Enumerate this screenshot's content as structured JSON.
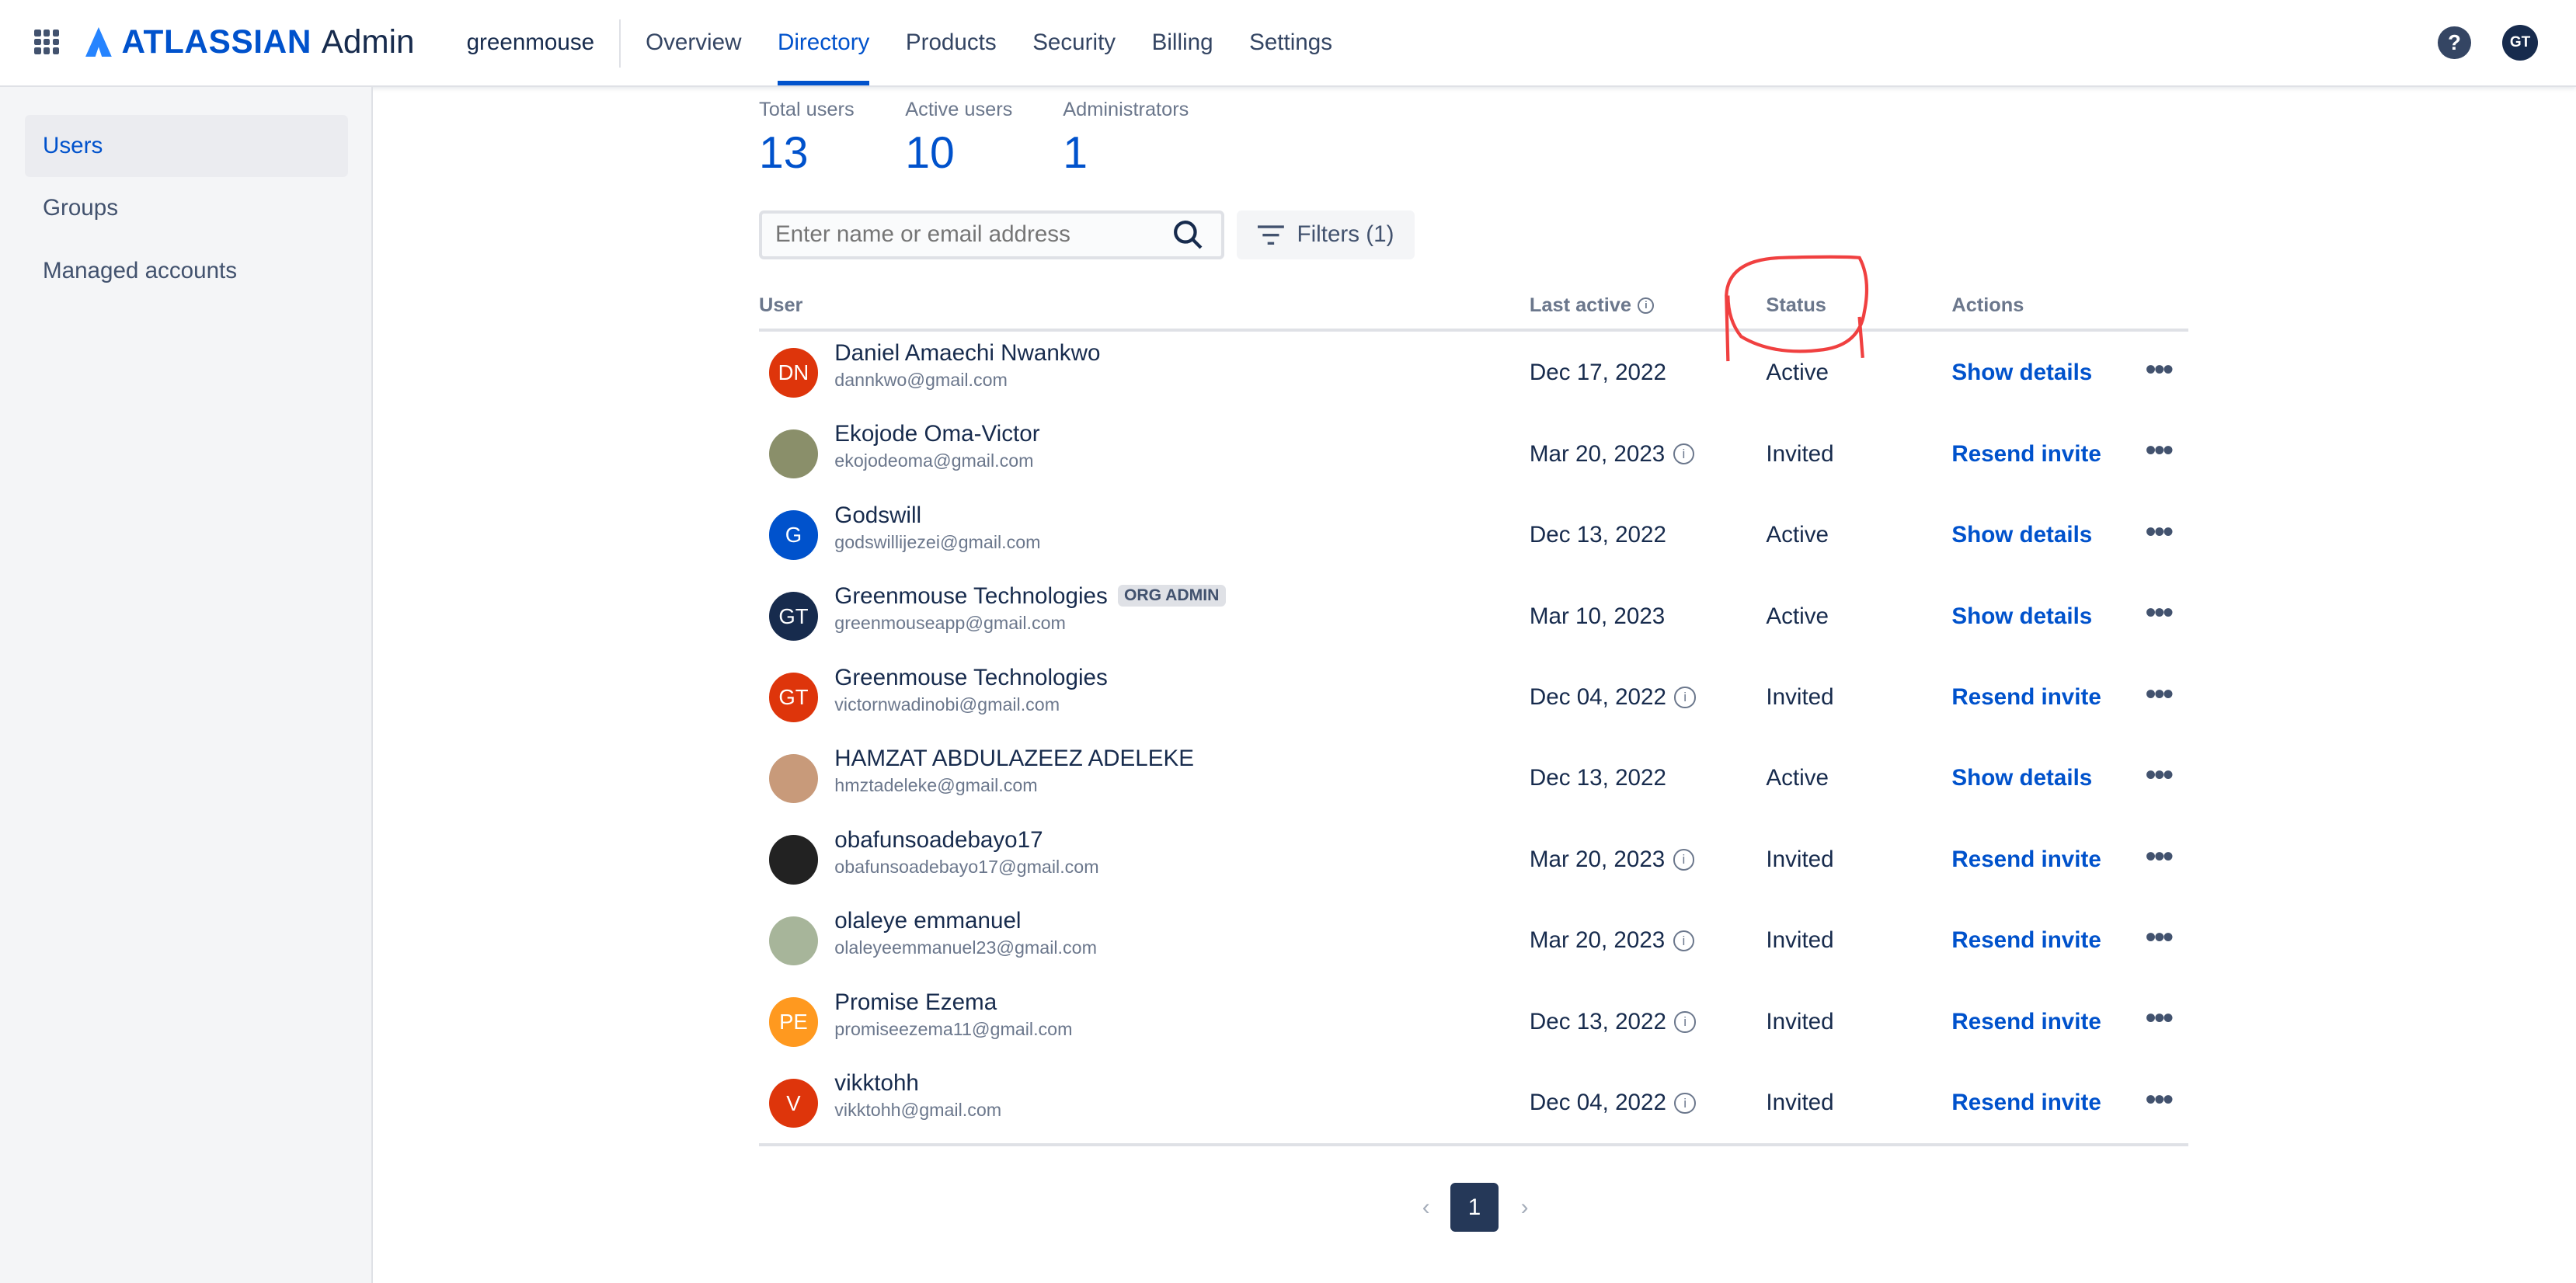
{
  "header": {
    "brand": "ATLASSIAN",
    "product": "Admin",
    "org": "greenmouse",
    "nav": [
      "Overview",
      "Directory",
      "Products",
      "Security",
      "Billing",
      "Settings"
    ],
    "active_nav": "Directory",
    "help": "?",
    "avatar": "GT"
  },
  "sidebar": {
    "items": [
      "Users",
      "Groups",
      "Managed accounts"
    ]
  },
  "stats": [
    {
      "label": "Total users",
      "value": "13"
    },
    {
      "label": "Active users",
      "value": "10"
    },
    {
      "label": "Administrators",
      "value": "1"
    }
  ],
  "search": {
    "placeholder": "Enter name or email address"
  },
  "filters": "Filters (1)",
  "columns": {
    "user": "User",
    "last_active": "Last active",
    "status": "Status",
    "actions": "Actions"
  },
  "rows": [
    {
      "initials": "DN",
      "color": "#de350b",
      "name": "Daniel Amaechi Nwankwo",
      "email": "dannkwo@gmail.com",
      "date": "Dec 17, 2022",
      "info": false,
      "status": "Active",
      "action": "Show details"
    },
    {
      "initials": "",
      "color": "#8a8f6a",
      "name": "Ekojode Oma-Victor",
      "email": "ekojodeoma@gmail.com",
      "date": "Mar 20, 2023",
      "info": true,
      "status": "Invited",
      "action": "Resend invite"
    },
    {
      "initials": "G",
      "color": "#0052cc",
      "name": "Godswill",
      "email": "godswillijezei@gmail.com",
      "date": "Dec 13, 2022",
      "info": false,
      "status": "Active",
      "action": "Show details"
    },
    {
      "initials": "GT",
      "color": "#172b4d",
      "name": "Greenmouse Technologies",
      "badge": "ORG ADMIN",
      "email": "greenmouseapp@gmail.com",
      "date": "Mar 10, 2023",
      "info": false,
      "status": "Active",
      "action": "Show details"
    },
    {
      "initials": "GT",
      "color": "#de350b",
      "name": "Greenmouse Technologies",
      "email": "victornwadinobi@gmail.com",
      "date": "Dec 04, 2022",
      "info": true,
      "status": "Invited",
      "action": "Resend invite"
    },
    {
      "initials": "",
      "color": "#c89a7a",
      "name": "HAMZAT ABDULAZEEZ ADELEKE",
      "email": "hmztadeleke@gmail.com",
      "date": "Dec 13, 2022",
      "info": false,
      "status": "Active",
      "action": "Show details"
    },
    {
      "initials": "",
      "color": "#222222",
      "name": "obafunsoadebayo17",
      "email": "obafunsoadebayo17@gmail.com",
      "date": "Mar 20, 2023",
      "info": true,
      "status": "Invited",
      "action": "Resend invite"
    },
    {
      "initials": "",
      "color": "#a7b59a",
      "name": "olaleye emmanuel",
      "email": "olaleyeemmanuel23@gmail.com",
      "date": "Mar 20, 2023",
      "info": true,
      "status": "Invited",
      "action": "Resend invite"
    },
    {
      "initials": "PE",
      "color": "#ff991f",
      "name": "Promise Ezema",
      "email": "promiseezema11@gmail.com",
      "date": "Dec 13, 2022",
      "info": true,
      "status": "Invited",
      "action": "Resend invite"
    },
    {
      "initials": "V",
      "color": "#de350b",
      "name": "vikktohh",
      "email": "vikktohh@gmail.com",
      "date": "Dec 04, 2022",
      "info": true,
      "status": "Invited",
      "action": "Resend invite"
    }
  ],
  "pagination": {
    "current": "1"
  },
  "colors": {
    "accent": "#0052cc",
    "annotation": "#f04040"
  }
}
